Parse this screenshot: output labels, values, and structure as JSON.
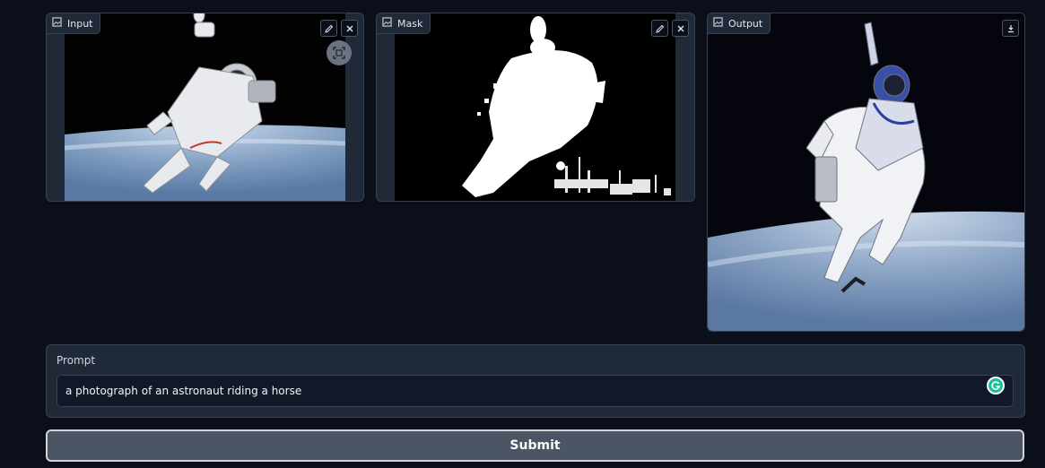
{
  "panels": {
    "input": {
      "label": "Input",
      "icon": "image-icon"
    },
    "mask": {
      "label": "Mask",
      "icon": "image-icon"
    },
    "output": {
      "label": "Output",
      "icon": "image-icon"
    }
  },
  "prompt": {
    "label": "Prompt",
    "value": "a photograph of an astronaut riding a horse"
  },
  "submit": {
    "label": "Submit"
  },
  "colors": {
    "background": "#0b0f19",
    "panel": "#1f2937",
    "border": "#374151",
    "submit_bg": "#4b5563",
    "grammarly": "#15c39a"
  }
}
